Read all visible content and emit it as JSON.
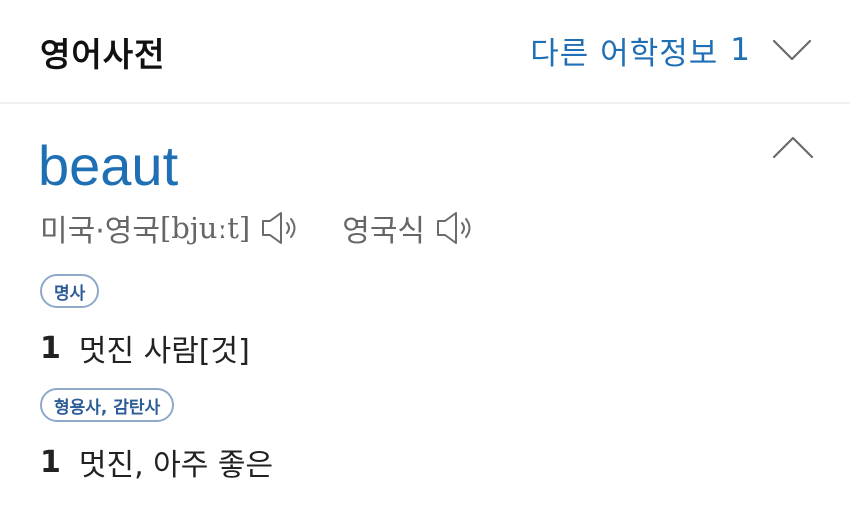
{
  "header": {
    "title": "영어사전",
    "other_info_label": "다른 어학정보",
    "other_info_count": "1",
    "expand_icon": "chevron-down-icon"
  },
  "entry": {
    "word": "beaut",
    "collapse_icon": "chevron-up-icon",
    "pronunciations": [
      {
        "label": "미국·영국",
        "ipa": "[bjuːt]",
        "icon": "speaker-icon"
      },
      {
        "label": "영국식",
        "ipa": "",
        "icon": "speaker-icon"
      }
    ],
    "senses": [
      {
        "pos": "명사",
        "number": "1",
        "meaning": "멋진 사람[것]"
      },
      {
        "pos": "형용사, 감탄사",
        "number": "1",
        "meaning": "멋진, 아주 좋은"
      }
    ]
  },
  "colors": {
    "accent": "#1f6fb5",
    "badge_border": "#8fa9c8",
    "badge_text": "#2d5d96",
    "muted_text": "#666666",
    "divider": "#eef0f2"
  }
}
